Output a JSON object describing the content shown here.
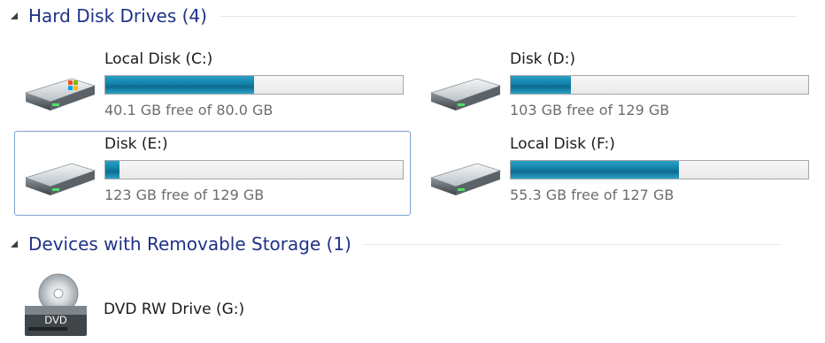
{
  "groups": [
    {
      "title": "Hard Disk Drives (4)"
    },
    {
      "title": "Devices with Removable Storage (1)"
    }
  ],
  "drives": [
    {
      "name": "Local Disk (C:)",
      "free_text": "40.1 GB free of 80.0 GB",
      "used_fraction": 0.499,
      "icon": "hard-drive-windows-icon"
    },
    {
      "name": "Disk (D:)",
      "free_text": "103 GB free of 129 GB",
      "used_fraction": 0.202,
      "icon": "hard-drive-icon"
    },
    {
      "name": "Disk (E:)",
      "free_text": "123 GB free of 129 GB",
      "used_fraction": 0.047,
      "icon": "hard-drive-icon",
      "selected": true
    },
    {
      "name": "Local Disk (F:)",
      "free_text": "55.3 GB free of 127 GB",
      "used_fraction": 0.565,
      "icon": "hard-drive-icon"
    }
  ],
  "removable": [
    {
      "name": "DVD RW Drive (G:)",
      "icon": "dvd-drive-icon",
      "badge": "DVD"
    }
  ],
  "colors": {
    "group_title": "#1e3287",
    "bar_fill": "#1385ac",
    "selection_border": "#7da2ce"
  }
}
